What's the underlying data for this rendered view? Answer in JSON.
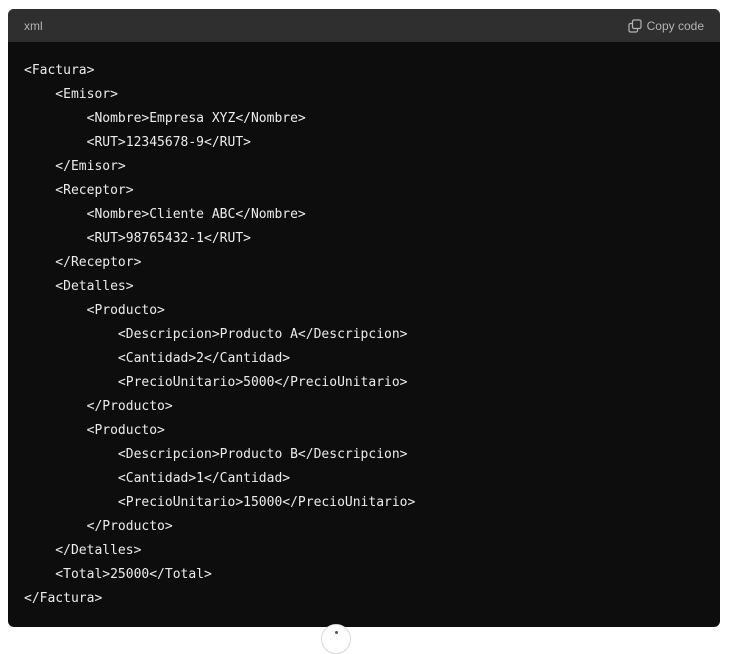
{
  "code_block": {
    "language": "xml",
    "copy_label": "Copy code",
    "copy_icon": "copy-icon",
    "lines": [
      "<Factura>",
      "    <Emisor>",
      "        <Nombre>Empresa XYZ</Nombre>",
      "        <RUT>12345678-9</RUT>",
      "    </Emisor>",
      "    <Receptor>",
      "        <Nombre>Cliente ABC</Nombre>",
      "        <RUT>98765432-1</RUT>",
      "    </Receptor>",
      "    <Detalles>",
      "        <Producto>",
      "            <Descripcion>Producto A</Descripcion>",
      "            <Cantidad>2</Cantidad>",
      "            <PrecioUnitario>5000</PrecioUnitario>",
      "        </Producto>",
      "        <Producto>",
      "            <Descripcion>Producto B</Descripcion>",
      "            <Cantidad>1</Cantidad>",
      "            <PrecioUnitario>15000</PrecioUnitario>",
      "        </Producto>",
      "    </Detalles>",
      "    <Total>25000</Total>",
      "</Factura>"
    ]
  },
  "colors": {
    "code_background": "#0d0d0d",
    "header_background": "#2f2f2f",
    "code_text": "#ececec",
    "header_text": "#b4b4b4"
  }
}
